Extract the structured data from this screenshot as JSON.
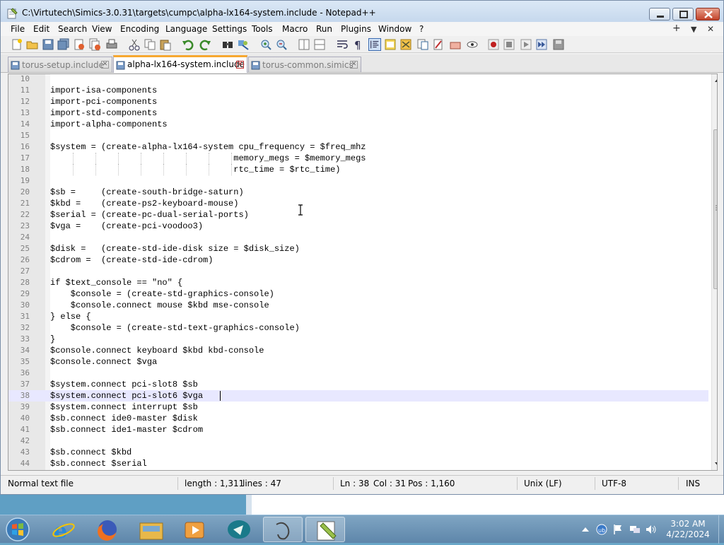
{
  "window": {
    "title": "C:\\Virtutech\\Simics-3.0.31\\targets\\cumpc\\alpha-lx164-system.include - Notepad++"
  },
  "menu": [
    "File",
    "Edit",
    "Search",
    "View",
    "Encoding",
    "Language",
    "Settings",
    "Tools",
    "Macro",
    "Run",
    "Plugins",
    "Window",
    "?"
  ],
  "menu_right": {
    "add": "+",
    "down": "▼",
    "close": "✕"
  },
  "tabs": [
    {
      "label": "torus-setup.include",
      "active": false
    },
    {
      "label": "alpha-lx164-system.include",
      "active": true
    },
    {
      "label": "torus-common.simics",
      "active": false
    }
  ],
  "editor": {
    "current_line": 38,
    "lines": [
      {
        "n": "10",
        "t": ""
      },
      {
        "n": "11",
        "t": "import-isa-components"
      },
      {
        "n": "12",
        "t": "import-pci-components"
      },
      {
        "n": "13",
        "t": "import-std-components"
      },
      {
        "n": "14",
        "t": "import-alpha-components"
      },
      {
        "n": "15",
        "t": ""
      },
      {
        "n": "16",
        "t": "$system = (create-alpha-lx164-system cpu_frequency = $freq_mhz"
      },
      {
        "n": "17",
        "t": "                                    memory_megs = $memory_megs"
      },
      {
        "n": "18",
        "t": "                                    rtc_time = $rtc_time)"
      },
      {
        "n": "19",
        "t": ""
      },
      {
        "n": "20",
        "t": "$sb =     (create-south-bridge-saturn)"
      },
      {
        "n": "21",
        "t": "$kbd =    (create-ps2-keyboard-mouse)"
      },
      {
        "n": "22",
        "t": "$serial = (create-pc-dual-serial-ports)"
      },
      {
        "n": "23",
        "t": "$vga =    (create-pci-voodoo3)"
      },
      {
        "n": "24",
        "t": ""
      },
      {
        "n": "25",
        "t": "$disk =   (create-std-ide-disk size = $disk_size)"
      },
      {
        "n": "26",
        "t": "$cdrom =  (create-std-ide-cdrom)"
      },
      {
        "n": "27",
        "t": ""
      },
      {
        "n": "28",
        "t": "if $text_console == \"no\" {"
      },
      {
        "n": "29",
        "t": "    $console = (create-std-graphics-console)"
      },
      {
        "n": "30",
        "t": "    $console.connect mouse $kbd mse-console"
      },
      {
        "n": "31",
        "t": "} else {"
      },
      {
        "n": "32",
        "t": "    $console = (create-std-text-graphics-console)"
      },
      {
        "n": "33",
        "t": "}"
      },
      {
        "n": "34",
        "t": "$console.connect keyboard $kbd kbd-console"
      },
      {
        "n": "35",
        "t": "$console.connect $vga"
      },
      {
        "n": "36",
        "t": ""
      },
      {
        "n": "37",
        "t": "$system.connect pci-slot8 $sb"
      },
      {
        "n": "38",
        "t": "$system.connect pci-slot6 $vga"
      },
      {
        "n": "39",
        "t": "$system.connect interrupt $sb"
      },
      {
        "n": "40",
        "t": "$sb.connect ide0-master $disk"
      },
      {
        "n": "41",
        "t": "$sb.connect ide1-master $cdrom"
      },
      {
        "n": "42",
        "t": ""
      },
      {
        "n": "43",
        "t": "$sb.connect $kbd"
      },
      {
        "n": "44",
        "t": "$sb.connect $serial"
      }
    ]
  },
  "status": {
    "type": "Normal text file",
    "length": "length : 1,311",
    "lines": "lines : 47",
    "ln": "Ln : 38",
    "col": "Col : 31",
    "pos": "Pos : 1,160",
    "eol": "Unix (LF)",
    "encoding": "UTF-8",
    "mode": "INS"
  },
  "taskbar": {
    "time": "3:02 AM",
    "date": "4/22/2024"
  },
  "colors": {
    "accent_tab": "#f7a830",
    "current_line": "#e8e8ff",
    "taskbar": "#5e86aa"
  }
}
